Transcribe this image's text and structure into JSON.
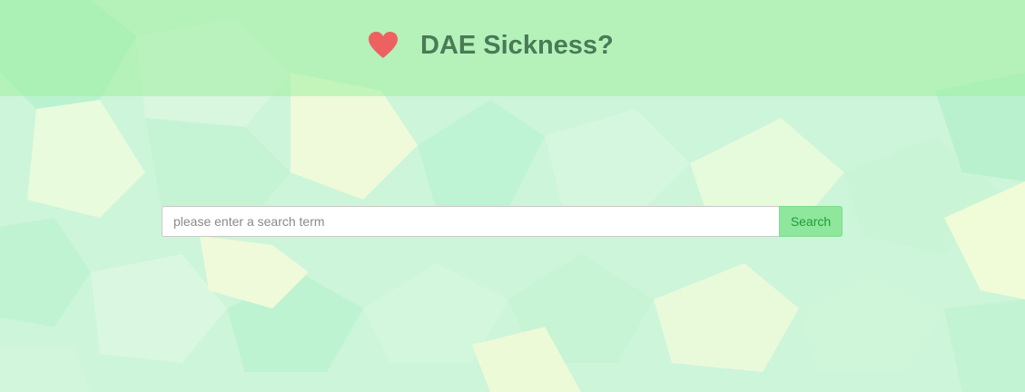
{
  "header": {
    "title": "DAE Sickness?",
    "logo_icon": "heart-icon"
  },
  "search": {
    "placeholder": "please enter a search term",
    "value": "",
    "button_label": "Search"
  },
  "colors": {
    "heart": "#ee6161",
    "title": "#4a7a56",
    "button_bg": "#8ee79c",
    "button_text": "#1f9a3c"
  }
}
